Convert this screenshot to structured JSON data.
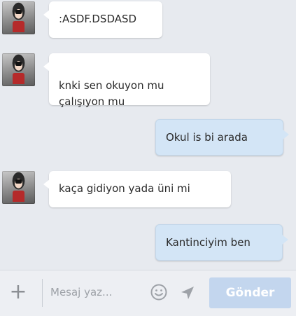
{
  "conversation": {
    "messages": [
      {
        "direction": "incoming",
        "text": ":ASDF.DSDASD"
      },
      {
        "direction": "incoming",
        "text": "knki sen okuyon mu\nçalışıyon mu"
      },
      {
        "direction": "outgoing",
        "text": "Okul is bi arada"
      },
      {
        "direction": "incoming",
        "text": "kaça  gidiyon yada üni mi"
      },
      {
        "direction": "outgoing",
        "text": "Kantinciyim ben"
      }
    ]
  },
  "composer": {
    "placeholder": "Mesaj yaz...",
    "send_label": "Gönder",
    "icons": [
      "plus-icon",
      "smiley-icon",
      "location-arrow-icon"
    ]
  },
  "colors": {
    "incoming_bubble": "#ffffff",
    "outgoing_bubble": "#d3e5f6",
    "send_button": "#c3d6ee",
    "background": "#e7eaef"
  }
}
